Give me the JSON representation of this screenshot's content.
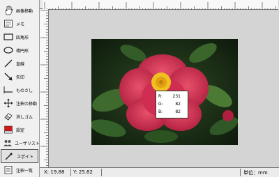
{
  "toolbar": {
    "tools": [
      {
        "label": "画像移動",
        "icon": "hand-icon"
      },
      {
        "label": "メモ",
        "icon": "memo-icon"
      },
      {
        "label": "四角形",
        "icon": "rectangle-icon"
      },
      {
        "label": "楕円形",
        "icon": "ellipse-icon"
      },
      {
        "label": "直線",
        "icon": "line-icon"
      },
      {
        "label": "矢印",
        "icon": "arrow-icon"
      },
      {
        "label": "ものさし",
        "icon": "ruler-icon"
      },
      {
        "label": "注釈の移動",
        "icon": "move-icon"
      },
      {
        "label": "消しゴム",
        "icon": "eraser-icon"
      },
      {
        "label": "設定",
        "icon": "settings-icon"
      },
      {
        "label": "ユーザリスト",
        "icon": "user-list-icon"
      },
      {
        "label": "スポイト",
        "icon": "eyedropper-icon",
        "active": true
      },
      {
        "label": "注釈一覧",
        "icon": "annotation-list-icon"
      }
    ]
  },
  "readout": {
    "r_label": "R:",
    "r_value": "231",
    "g_label": "G:",
    "g_value": "82",
    "b_label": "B:",
    "b_value": "82"
  },
  "status": {
    "x": "X: 19.88",
    "y": "Y: 25.82",
    "unit": "単位：mm"
  },
  "colors": {
    "sampled": "#e75252",
    "photo_background": "#1b2a18",
    "petal": "#c8284a",
    "stamen": "#f0c020"
  }
}
